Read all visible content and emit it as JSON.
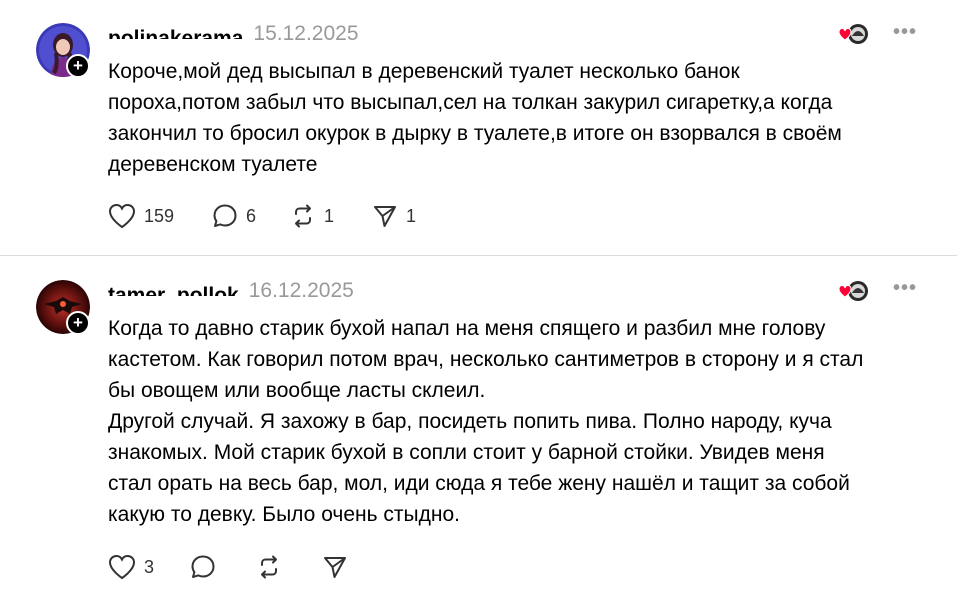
{
  "posts": [
    {
      "username": "polinakerama",
      "date": "15.12.2025",
      "text_lines": [
        "Короче,мой дед высыпал в деревенский туалет несколько банок",
        "пороха,потом забыл что высыпал,сел на толкан закурил сигаретку,а когда",
        "закончил то бросил окурок в дырку в туалете,в итоге он взорвался в своём",
        "деревенском туалете"
      ],
      "likes": "159",
      "replies": "6",
      "reposts": "1",
      "shares": "1"
    },
    {
      "username": "tamer_pollok",
      "date": "16.12.2025",
      "text_lines": [
        "Когда то давно старик бухой напал на меня спящего и разбил мне голову",
        "кастетом. Как говорил потом врач, несколько сантиметров в сторону и я стал",
        "бы овощем или вообще ласты склеил.",
        "Другой случай. Я захожу в бар, посидеть попить пива. Полно народу, куча",
        "знакомых. Мой старик бухой в сопли стоит у барной стойки. Увидев меня",
        "стал орать на весь бар, мол, иди сюда я тебе жену нашёл и тащит за собой",
        "какую то девку. Было очень стыдно."
      ],
      "likes": "3",
      "replies": "",
      "reposts": "",
      "shares": ""
    }
  ],
  "icons": {
    "follow": "+",
    "more": "•••"
  },
  "colors": {
    "heart_liked": "#ff0034",
    "muted": "#999999",
    "divider": "#dcdcdc"
  }
}
